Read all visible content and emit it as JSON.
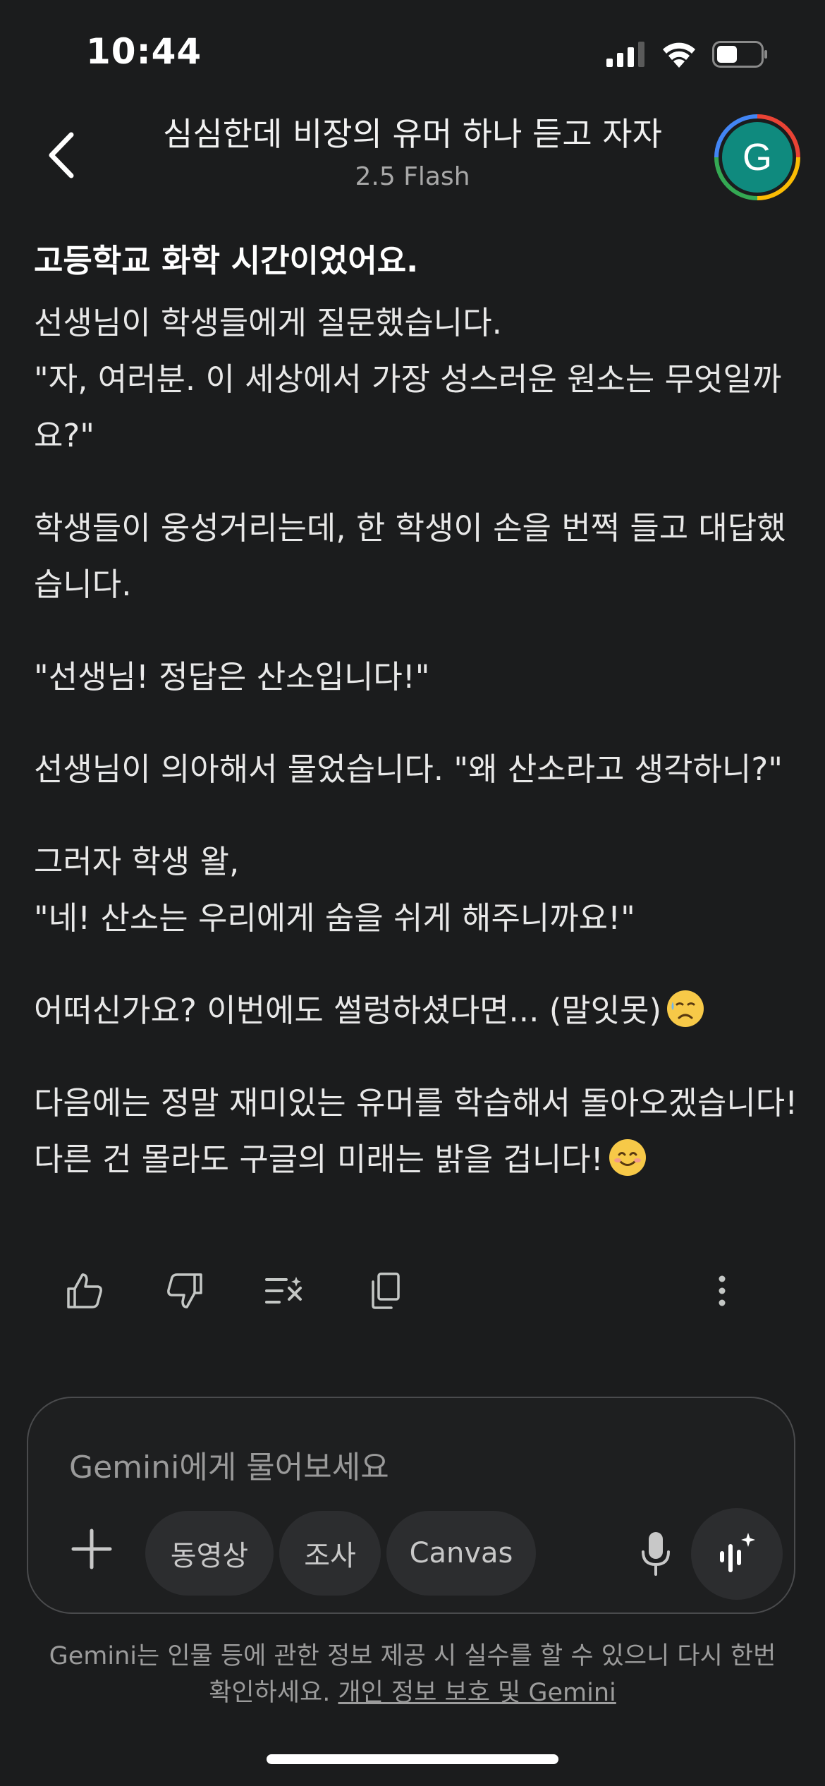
{
  "status_bar": {
    "time": "10:44",
    "icons": [
      "signal-icon",
      "wifi-icon",
      "battery-icon"
    ]
  },
  "header": {
    "title": "심심한데 비장의 유머 하나 듣고 자자",
    "model": "2.5 Flash",
    "avatar_letter": "G"
  },
  "message": {
    "heading": "고등학교 화학 시간이었어요.",
    "p1_line1": "선생님이 학생들에게 질문했습니다.",
    "p1_line2": "\"자, 여러분. 이 세상에서 가장 성스러운 원소는 무엇일까요?\"",
    "p2": "학생들이 웅성거리는데, 한 학생이 손을 번쩍 들고 대답했습니다.",
    "p3": "\"선생님! 정답은 산소입니다!\"",
    "p4": "선생님이 의아해서 물었습니다. \"왜 산소라고 생각하니?\"",
    "p5": "그러자 학생 왈,",
    "p6": "\"네! 산소는 우리에게 숨을 쉬게 해주니까요!\"",
    "p7": "어떠신가요? 이번에도 썰렁하셨다면... (말잇못)",
    "p8_line1": "다음에는 정말 재미있는 유머를 학습해서 돌아오겠습니다!",
    "p8_line2": "다른 건 몰라도 구글의 미래는 밝을 겁니다!"
  },
  "actions": [
    "thumbs-up-icon",
    "thumbs-down-icon",
    "modify-response-icon",
    "copy-icon",
    "more-vert-icon"
  ],
  "input": {
    "placeholder": "Gemini에게 물어보세요",
    "chips": [
      "동영상",
      "조사",
      "Canvas"
    ]
  },
  "disclaimer": {
    "text": "Gemini는 인물 등에 관한 정보 제공 시 실수를 할 수 있으니 다시 한번 확인하세요. ",
    "link": "개인 정보 보호 및 Gemini"
  },
  "colors": {
    "background": "#1b1c1d",
    "text": "#e8e8e8",
    "muted": "#9c9c9c",
    "chip": "#2c2d2f",
    "avatar": "#0f8a7e"
  }
}
